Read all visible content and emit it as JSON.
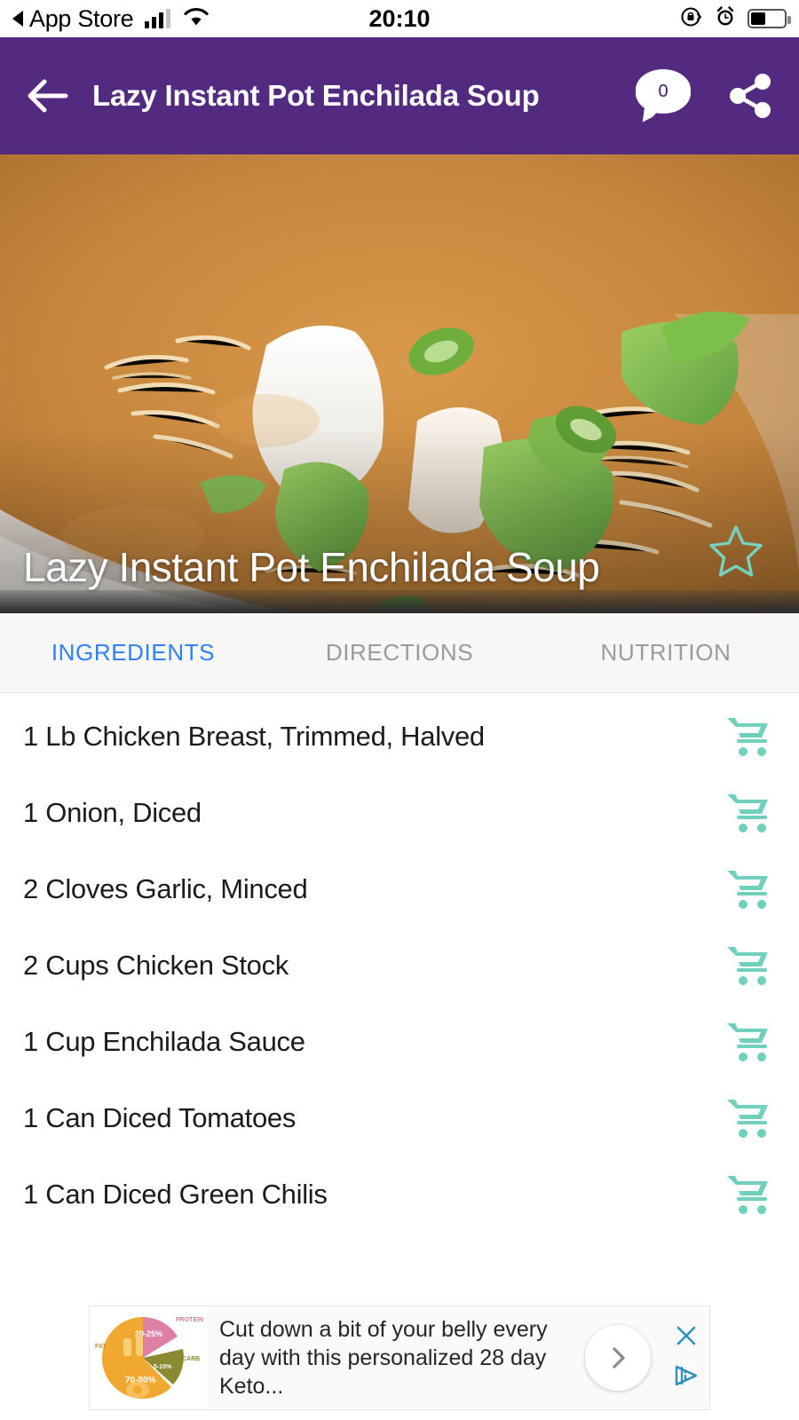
{
  "status_bar": {
    "back_label": "App Store",
    "time": "20:10",
    "icons": [
      "signal-bars-icon",
      "wifi-icon",
      "rotation-lock-icon",
      "alarm-clock-icon",
      "battery-icon"
    ]
  },
  "app_bar": {
    "back_icon": "back-arrow-icon",
    "title": "Lazy Instant Pot Enchilada Soup",
    "comment_count": "0",
    "comment_icon": "comment-bubble-icon",
    "share_icon": "share-icon"
  },
  "hero": {
    "caption": "Lazy Instant Pot Enchilada Soup",
    "favorite_icon": "star-outline-icon",
    "favorite_color": "#74D2BE"
  },
  "tabs": [
    {
      "label": "INGREDIENTS",
      "active": true
    },
    {
      "label": "DIRECTIONS",
      "active": false
    },
    {
      "label": "NUTRITION",
      "active": false
    }
  ],
  "tab_colors": {
    "active": "#2f82f7",
    "inactive": "#9b9b9b"
  },
  "ingredients": [
    {
      "text": "1 Lb Chicken Breast, Trimmed, Halved",
      "action_icon": "shopping-cart-icon"
    },
    {
      "text": "1 Onion, Diced",
      "action_icon": "shopping-cart-icon"
    },
    {
      "text": "2 Cloves Garlic, Minced",
      "action_icon": "shopping-cart-icon"
    },
    {
      "text": "2 Cups Chicken Stock",
      "action_icon": "shopping-cart-icon"
    },
    {
      "text": "1 Cup Enchilada Sauce",
      "action_icon": "shopping-cart-icon"
    },
    {
      "text": "1 Can Diced Tomatoes",
      "action_icon": "shopping-cart-icon"
    },
    {
      "text": "1 Can Diced Green Chilis",
      "action_icon": "shopping-cart-icon"
    }
  ],
  "ad": {
    "text": "Cut down a bit of your belly every day with this personalized 28 day Keto...",
    "close_icon": "close-icon",
    "adchoices_icon": "adchoices-icon",
    "cta_icon": "chevron-right-icon",
    "thumbnail": {
      "type": "pie",
      "slices": [
        {
          "label": "FAT",
          "value": "70-80%",
          "color": "#F0A830"
        },
        {
          "label": "PROTEIN",
          "value": "20-25%",
          "color": "#DE7FA4"
        },
        {
          "label": "CARB",
          "value": "5-10%",
          "color": "#8A8A32"
        }
      ]
    }
  },
  "colors": {
    "brand_purple": "#522A80",
    "accent_mint": "#6FD0BD",
    "tab_active_blue": "#2f82f7"
  }
}
